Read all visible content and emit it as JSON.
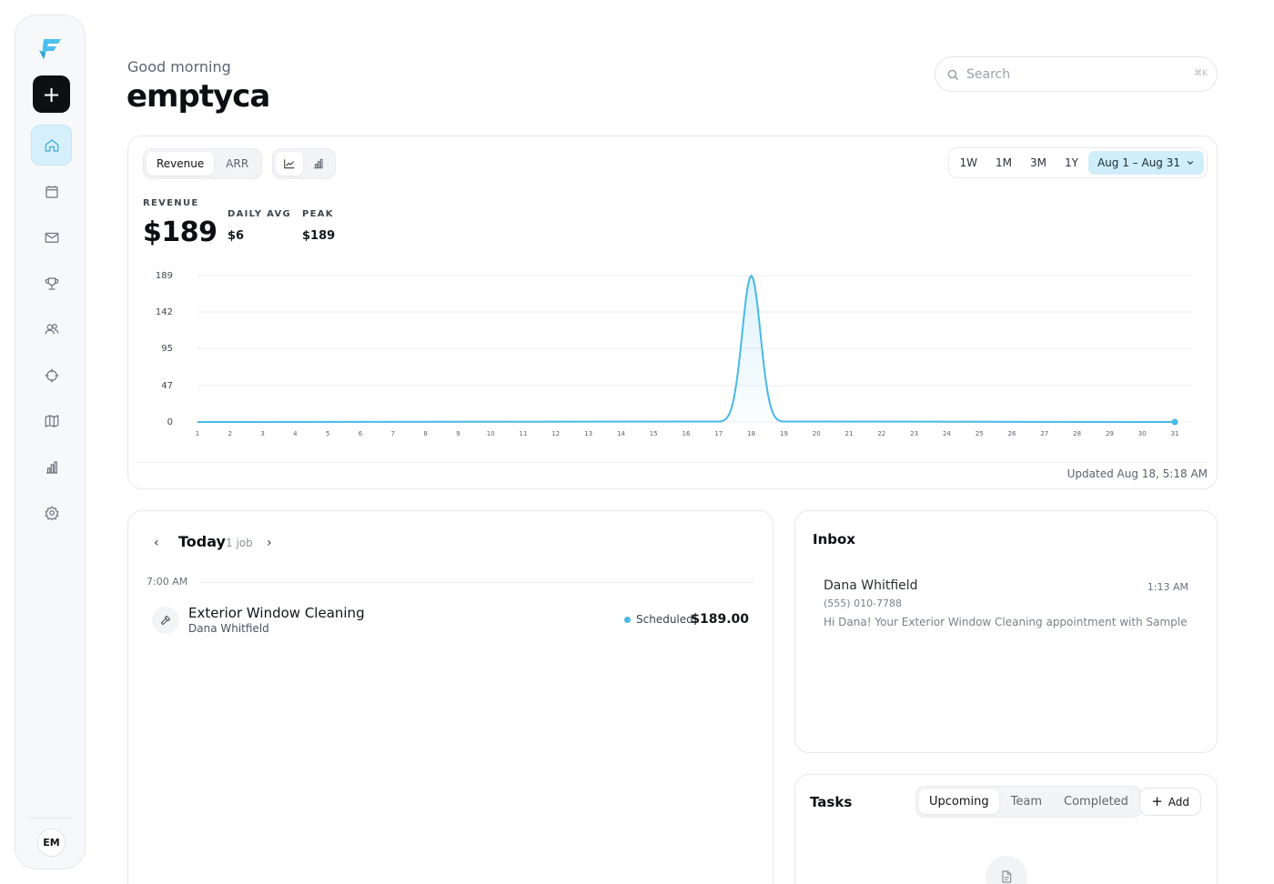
{
  "sidebar": {
    "logo_icon": "brand-f-logo",
    "new_button_icon": "plus-icon",
    "new_button_label": "+",
    "items": [
      {
        "icon": "home-icon",
        "active": true
      },
      {
        "icon": "calendar-icon",
        "active": false
      },
      {
        "icon": "mail-icon",
        "active": false
      },
      {
        "icon": "trophy-icon",
        "active": false
      },
      {
        "icon": "users-icon",
        "active": false
      },
      {
        "icon": "crosshair-icon",
        "active": false
      },
      {
        "icon": "map-icon",
        "active": false
      },
      {
        "icon": "bar-chart-icon",
        "active": false
      },
      {
        "icon": "settings-icon",
        "active": false
      }
    ],
    "avatar_initials": "EM"
  },
  "header": {
    "greeting": "Good morning",
    "name": "emptyca"
  },
  "search": {
    "placeholder": "Search",
    "shortcut": "⌘K"
  },
  "chart_panel": {
    "metric_tabs": [
      {
        "label": "Revenue",
        "active": true
      },
      {
        "label": "ARR",
        "active": false
      }
    ],
    "view_toggle": [
      {
        "icon": "line-chart-icon",
        "active": true
      },
      {
        "icon": "bar-chart-icon",
        "active": false
      }
    ],
    "ranges": [
      "1W",
      "1M",
      "3M",
      "1Y"
    ],
    "date_range": "Aug 1 – Aug 31",
    "stats": {
      "revenue_label": "REVENUE",
      "revenue_value": "$189",
      "daily_avg_label": "DAILY AVG",
      "daily_avg_value": "$6",
      "peak_label": "PEAK",
      "peak_value": "$189"
    },
    "updated": "Updated Aug 18, 5:18 AM",
    "accent": "#47b9e6"
  },
  "chart_data": {
    "type": "area",
    "x": [
      1,
      2,
      3,
      4,
      5,
      6,
      7,
      8,
      9,
      10,
      11,
      12,
      13,
      14,
      15,
      16,
      17,
      18,
      19,
      20,
      21,
      22,
      23,
      24,
      25,
      26,
      27,
      28,
      29,
      30,
      31
    ],
    "series": [
      {
        "values": [
          0,
          0,
          0,
          0,
          0,
          0,
          0,
          0,
          0,
          0,
          0,
          0,
          0,
          0,
          0,
          0,
          0,
          189,
          0,
          0,
          0,
          0,
          0,
          0,
          0,
          0,
          0,
          0,
          0,
          0,
          0
        ]
      }
    ],
    "yticks": [
      "0",
      "47",
      "95",
      "142",
      "189"
    ],
    "ylim": [
      0,
      189
    ],
    "grid": true
  },
  "schedule": {
    "title": "Today",
    "count": "1 job",
    "time_slot": "7:00 AM",
    "job": {
      "title": "Exterior Window Cleaning",
      "client": "Dana Whitfield",
      "status": "Scheduled",
      "price": "$189.00",
      "icon": "hammer-icon"
    }
  },
  "inbox": {
    "title": "Inbox",
    "message": {
      "name": "Dana Whitfield",
      "time": "1:13 AM",
      "phone": "(555) 010-7788",
      "preview": "Hi Dana! Your Exterior Window Cleaning appointment with Sample Sh"
    }
  },
  "tasks": {
    "title": "Tasks",
    "tabs": [
      {
        "label": "Upcoming",
        "active": true
      },
      {
        "label": "Team",
        "active": false
      },
      {
        "label": "Completed",
        "active": false
      }
    ],
    "add_label": "Add",
    "empty_icon": "document-icon"
  }
}
